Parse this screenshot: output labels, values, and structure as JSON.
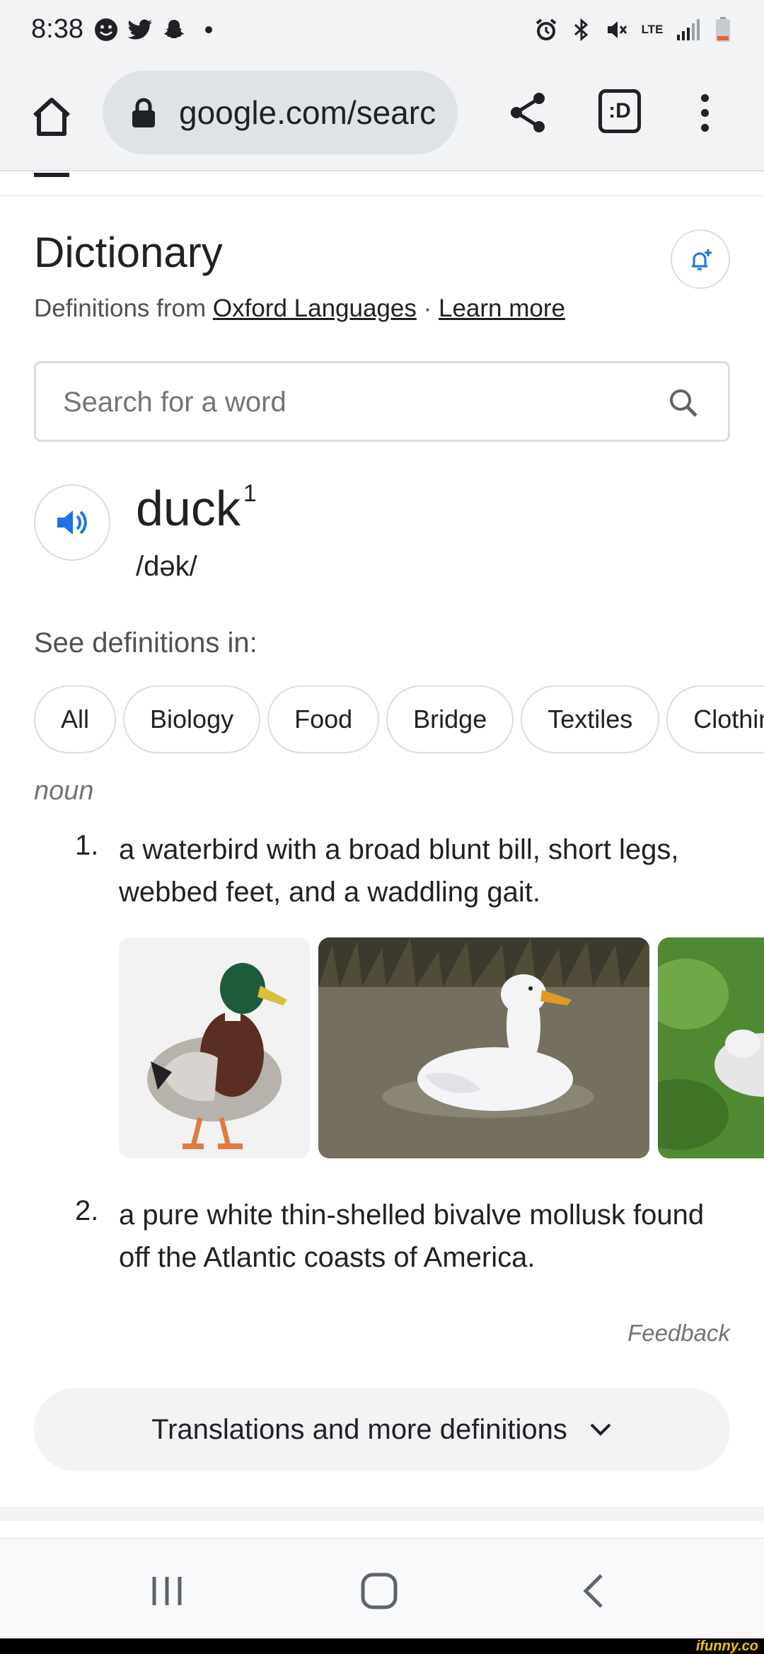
{
  "status_bar": {
    "time": "8:38",
    "lte": "LTE"
  },
  "toolbar": {
    "url": "google.com/searc",
    "tabs_label": ":D"
  },
  "dictionary": {
    "title": "Dictionary",
    "source_prefix": "Definitions from",
    "source_link": "Oxford Languages",
    "separator": "·",
    "learn_more": "Learn more",
    "search_placeholder": "Search for a word",
    "headword": "duck",
    "headword_sup": "1",
    "phonetic": "/dək/",
    "see_definitions_in": "See definitions in:",
    "chips": [
      "All",
      "Biology",
      "Food",
      "Bridge",
      "Textiles",
      "Clothing"
    ],
    "part_of_speech": "noun",
    "definitions": [
      {
        "number": "1.",
        "text": "a waterbird with a broad blunt bill, short legs, webbed feet, and a waddling gait."
      },
      {
        "number": "2.",
        "text": "a pure white thin-shelled bivalve mollusk found off the Atlantic coasts of America."
      }
    ],
    "feedback": "Feedback",
    "translations_button": "Translations and more definitions"
  },
  "watermark": "ifunny.co",
  "colors": {
    "accent_blue": "#1a73e8",
    "chrome_bg": "#f1f3f4",
    "text_primary": "#202124",
    "text_secondary": "#70757a"
  }
}
